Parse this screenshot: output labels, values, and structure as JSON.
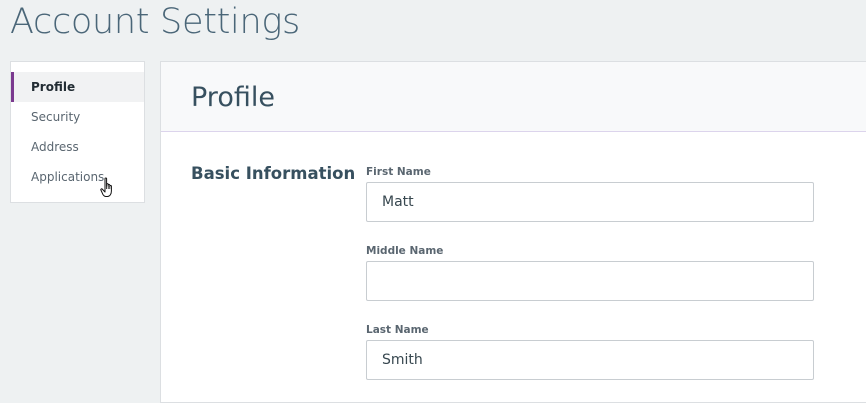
{
  "page": {
    "title": "Account Settings"
  },
  "sidebar": {
    "items": [
      {
        "label": "Profile",
        "active": true
      },
      {
        "label": "Security",
        "active": false
      },
      {
        "label": "Address",
        "active": false
      },
      {
        "label": "Applications",
        "active": false
      }
    ]
  },
  "panel": {
    "title": "Profile",
    "section_title": "Basic Information",
    "fields": [
      {
        "label": "First Name",
        "value": "Matt"
      },
      {
        "label": "Middle Name",
        "value": ""
      },
      {
        "label": "Last Name",
        "value": "Smith"
      }
    ]
  },
  "colors": {
    "accent": "#7b3a8f",
    "background": "#eef1f2",
    "title_text": "#4a6678"
  },
  "icons": {
    "cursor": "hand-pointer-icon"
  }
}
